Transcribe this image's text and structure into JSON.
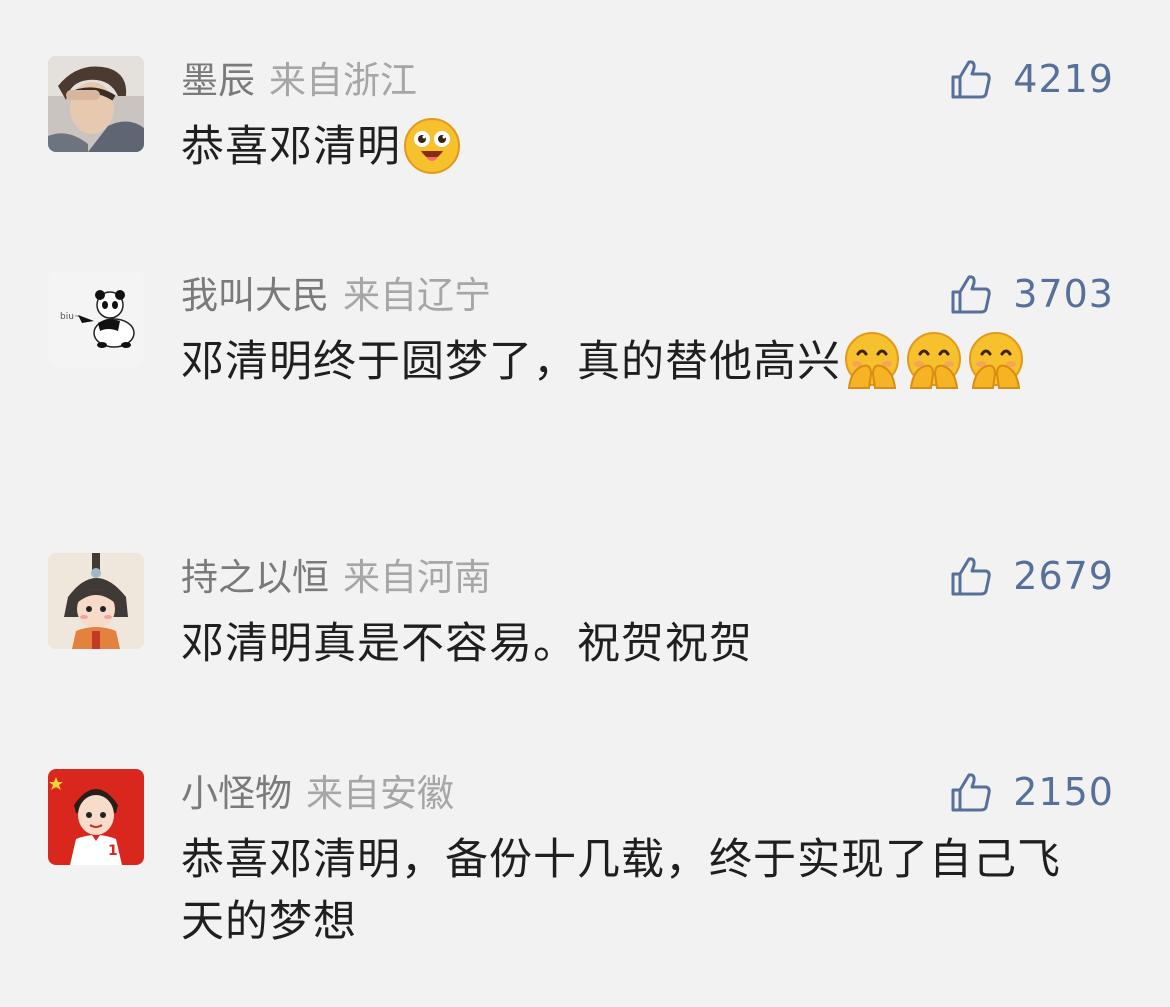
{
  "comments": [
    {
      "username": "墨辰",
      "location": "来自浙江",
      "likes": "4219",
      "text": "恭喜邓清明",
      "emojis": [
        "star-struck-emoji"
      ]
    },
    {
      "username": "我叫大民",
      "location": "来自辽宁",
      "likes": "3703",
      "text": "邓清明终于圆梦了，真的替他高兴",
      "emojis": [
        "hand-over-mouth-emoji",
        "hand-over-mouth-emoji",
        "hand-over-mouth-emoji"
      ],
      "avatar_text": "biu~"
    },
    {
      "username": "持之以恒",
      "location": "来自河南",
      "likes": "2679",
      "text": "邓清明真是不容易。祝贺祝贺",
      "emojis": []
    },
    {
      "username": "小怪物",
      "location": "来自安徽",
      "likes": "2150",
      "text": "恭喜邓清明，备份十几载，终于实现了自己飞天的梦想",
      "emojis": [],
      "avatar_text": "100"
    }
  ],
  "colors": {
    "background": "#f2f2f2",
    "like_count": "#57709a",
    "username": "#7a7a7a",
    "location": "#a6a6a6",
    "text": "#1f1f1f"
  }
}
